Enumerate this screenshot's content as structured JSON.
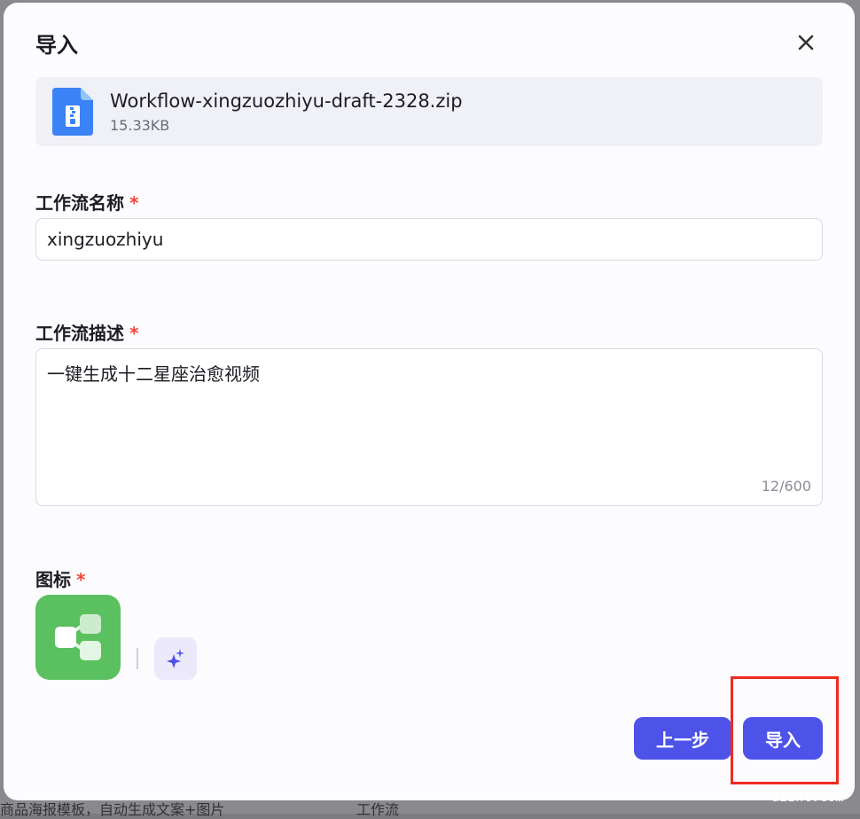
{
  "dialog": {
    "title": "导入",
    "file": {
      "name": "Workflow-xingzuozhiyu-draft-2328.zip",
      "size": "15.33KB"
    },
    "name_field": {
      "label": "工作流名称",
      "required_mark": "*",
      "value": "xingzuozhiyu"
    },
    "desc_field": {
      "label": "工作流描述",
      "required_mark": "*",
      "value": "一键生成十二星座治愈视频",
      "char_count": "12/600"
    },
    "icon_field": {
      "label": "图标",
      "required_mark": "*",
      "icon": "workflow-icon",
      "icon_color": "#5bc05f",
      "ai_button_icon": "sparkle-icon"
    },
    "buttons": {
      "prev_label": "上一步",
      "import_label": "导入"
    }
  },
  "background": {
    "bottom_items": [
      "商品海报模板，自动生成文案+图片",
      "工作流"
    ]
  },
  "watermark": "aiznt.com",
  "colors": {
    "primary": "#4d53e8",
    "required": "#f5433b",
    "highlight": "#ee2a20",
    "file_icon": "#3b82f6"
  }
}
